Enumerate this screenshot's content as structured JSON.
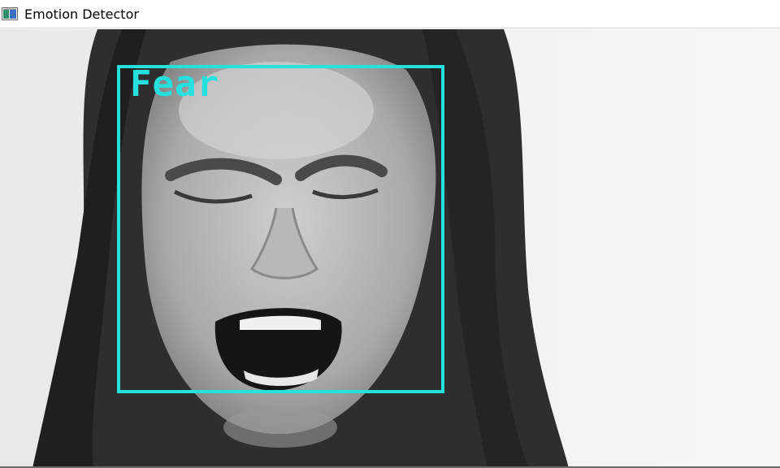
{
  "window": {
    "title": "Emotion Detector",
    "icon": "app-window-icon"
  },
  "detection": {
    "label": "Fear",
    "box_color": "#26e0e0"
  }
}
